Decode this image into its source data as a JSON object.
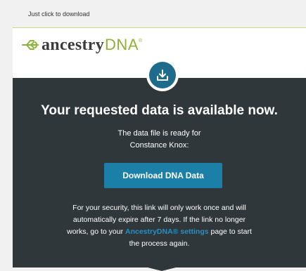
{
  "preheader": {
    "text": "Just click to download"
  },
  "logo": {
    "word": "ancestry",
    "suffix": "DNA",
    "trademark": "®",
    "colors": {
      "word": "#3b3b3b",
      "suffix": "#8cb23a"
    }
  },
  "panel": {
    "background": "#2f373b",
    "icon": "download-icon",
    "headline": "Your requested data is available now.",
    "ready_line_1": "The data file is ready for",
    "ready_line_2": "Constance Knox:",
    "download_button": "Download DNA Data",
    "security_line_1": "For your security, this link will only work once and will",
    "security_line_2": "automatically expire after 7 days. If the link no longer",
    "security_line_3_before": "works, go to your ",
    "security_link": "AncestryDNA® settings",
    "security_line_3_after": " page to start",
    "security_line_4": "the process again.",
    "accent_color": "#1c7fa8",
    "link_color": "#2a8fc0"
  }
}
